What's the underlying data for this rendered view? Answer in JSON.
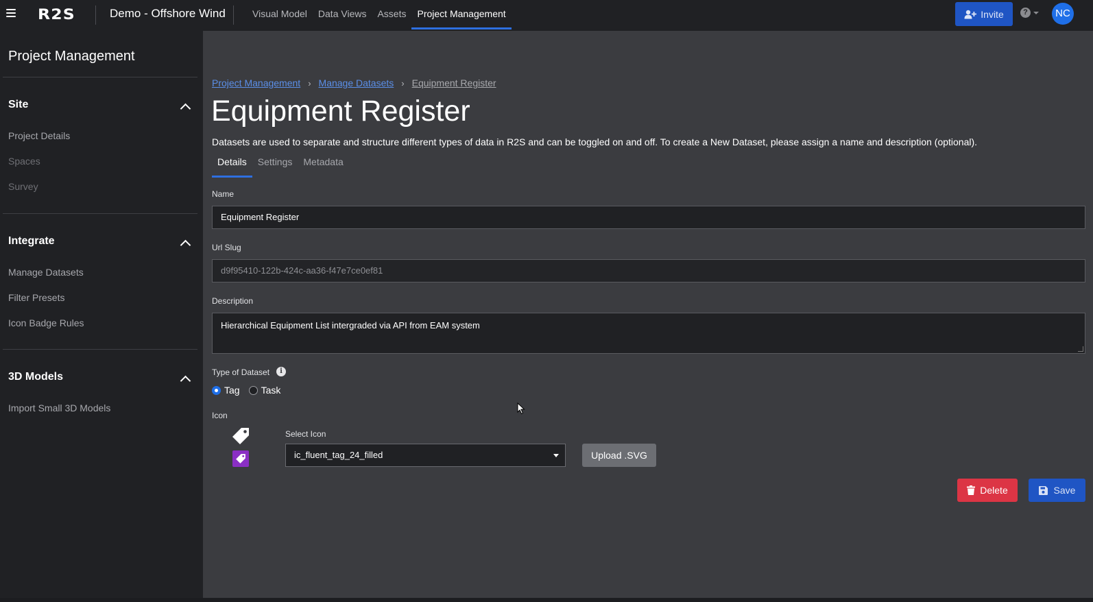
{
  "topbar": {
    "logo": "R2S",
    "project_name": "Demo - Offshore Wind",
    "nav": [
      "Visual Model",
      "Data Views",
      "Assets",
      "Project Management"
    ],
    "active_nav": "Project Management",
    "invite_label": "Invite",
    "help_glyph": "?",
    "avatar_initials": "NC"
  },
  "sidebar": {
    "title": "Project Management",
    "sections": [
      {
        "title": "Site",
        "items": [
          "Project Details",
          "Spaces",
          "Survey"
        ]
      },
      {
        "title": "Integrate",
        "items": [
          "Manage Datasets",
          "Filter Presets",
          "Icon Badge Rules"
        ]
      },
      {
        "title": "3D Models",
        "items": [
          "Import Small 3D Models"
        ]
      }
    ]
  },
  "breadcrumb": {
    "items": [
      "Project Management",
      "Manage Datasets"
    ],
    "current": "Equipment Register",
    "separator": "›"
  },
  "page": {
    "title": "Equipment Register",
    "description": "Datasets are used to separate and structure different types of data in R2S and can be toggled on and off. To create a New Dataset, please assign a name and description (optional)."
  },
  "tabs": [
    "Details",
    "Settings",
    "Metadata"
  ],
  "active_tab": "Details",
  "form": {
    "name_label": "Name",
    "name_value": "Equipment Register",
    "slug_label": "Url Slug",
    "slug_value": "d9f95410-122b-424c-aa36-f47e7ce0ef81",
    "description_label": "Description",
    "description_value": "Hierarchical Equipment List intergraded via API from EAM system",
    "type_label": "Type of Dataset",
    "type_options": [
      "Tag",
      "Task"
    ],
    "type_selected": "Tag",
    "icon_label": "Icon",
    "select_icon_label": "Select Icon",
    "select_icon_value": "ic_fluent_tag_24_filled",
    "upload_label": "Upload .SVG",
    "delete_label": "Delete",
    "save_label": "Save"
  },
  "colors": {
    "accent": "#2e6fe0",
    "primary_button": "#1f55c4",
    "danger": "#dc3545",
    "icon_badge": "#8a2fc4",
    "link": "#5b8fe8"
  },
  "icons": [
    "hamburger-icon",
    "user-plus-icon",
    "help-icon",
    "chevron-up-icon",
    "info-icon",
    "tag-icon",
    "trash-icon",
    "save-icon"
  ]
}
